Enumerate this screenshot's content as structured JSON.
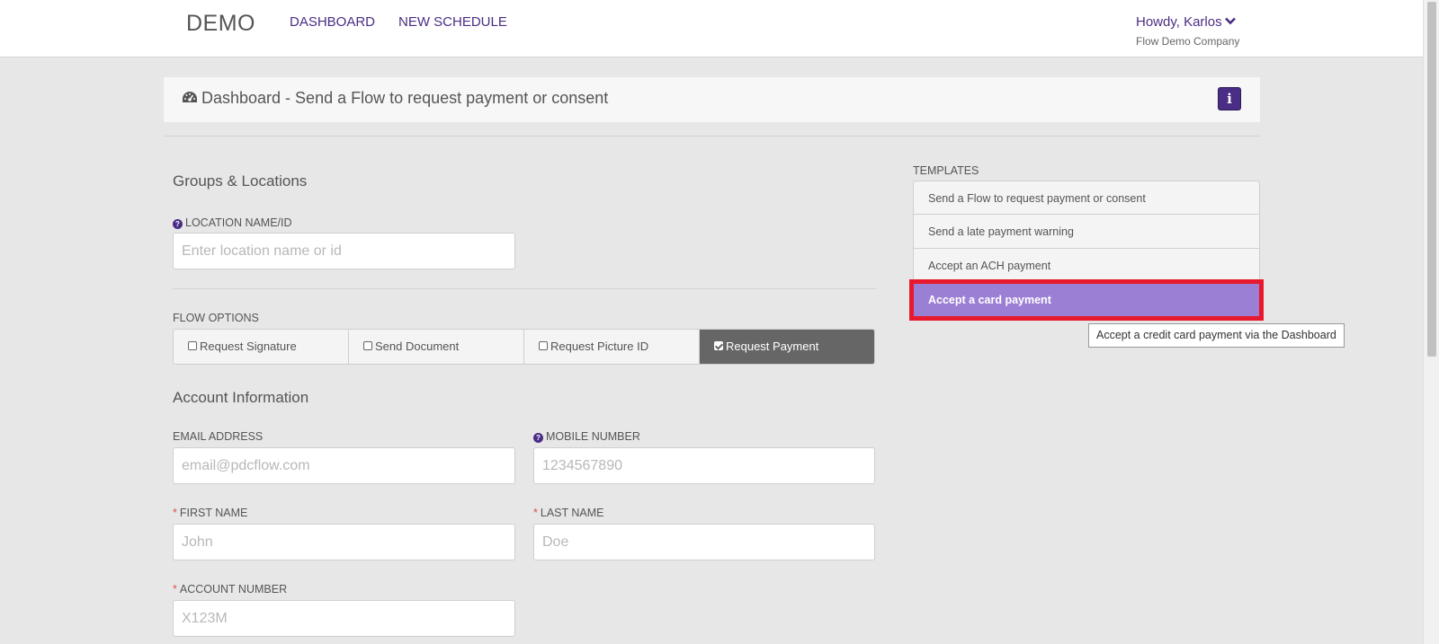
{
  "nav": {
    "brand": "DEMO",
    "links": [
      "DASHBOARD",
      "NEW SCHEDULE"
    ],
    "user_greeting": "Howdy, Karlos",
    "company": "Flow Demo Company"
  },
  "header": {
    "title": "Dashboard - Send a Flow to request payment or consent",
    "info_label": "i"
  },
  "groups": {
    "title": "Groups & Locations",
    "location_label": "LOCATION NAME/ID",
    "location_placeholder": "Enter location name or id"
  },
  "flow_options": {
    "label": "FLOW OPTIONS",
    "options": [
      {
        "label": "Request Signature",
        "checked": false
      },
      {
        "label": "Send Document",
        "checked": false
      },
      {
        "label": "Request Picture ID",
        "checked": false
      },
      {
        "label": "Request Payment",
        "checked": true
      }
    ]
  },
  "account": {
    "title": "Account Information",
    "email_label": "EMAIL ADDRESS",
    "email_placeholder": "email@pdcflow.com",
    "mobile_label": "MOBILE NUMBER",
    "mobile_placeholder": "1234567890",
    "first_label": "FIRST NAME",
    "first_placeholder": "John",
    "last_label": "LAST NAME",
    "last_placeholder": "Doe",
    "account_label": "ACCOUNT NUMBER",
    "account_placeholder": "X123M",
    "required_mark": "*"
  },
  "templates": {
    "label": "TEMPLATES",
    "items": [
      "Send a Flow to request payment or consent",
      "Send a late payment warning",
      "Accept an ACH payment",
      "Accept a card payment"
    ],
    "active_index": 3,
    "tooltip": "Accept a credit card payment via the Dashboard"
  },
  "colors": {
    "brand_purple": "#4a2d84",
    "active_template": "#9b7fd5",
    "highlight_red": "#e8192c",
    "active_option": "#666666"
  }
}
